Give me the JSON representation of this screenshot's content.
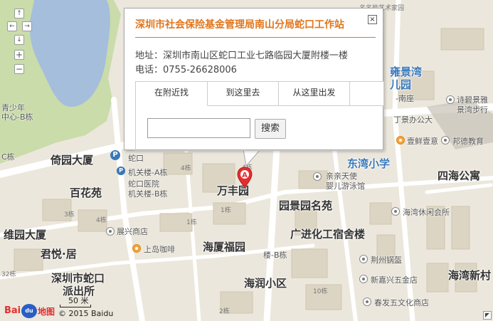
{
  "popup": {
    "title": "深圳市社会保险基金管理局南山分局蛇口工作站",
    "address": "地址：深圳市南山区蛇口工业七路临园大厦附楼一楼",
    "phone": "电话：0755-26628006",
    "close_icon": "×",
    "tabs": [
      "在附近找",
      "到这里去",
      "从这里出发"
    ],
    "search_value": "",
    "search_button": "搜索"
  },
  "nav": {
    "up": "↑",
    "left": "←",
    "right": "→",
    "down": "↓",
    "zoom_in": "+",
    "zoom_out": "−"
  },
  "marker_label": "A",
  "labels": {
    "top_clip": "名名能艺术家园",
    "yongjing": "雍景湾",
    "ergarden": "儿园",
    "nanzuo": "-南座",
    "shijing": "诗碧景雅",
    "shijing2": "景湾步行",
    "jingxiao": "丁景办公大",
    "yixian": "壹鲜壹意",
    "bangde": "邦德教育",
    "wanxiao": "东湾小学",
    "sihai": "四海公寓",
    "qinqin": "亲亲天使",
    "qinqin2": "婴儿游泳馆",
    "yuanjing": "园景园名苑",
    "haiwan_club": "海湾休闲会所",
    "guangxi": "广进化工宿舍楼",
    "jingzhou": "荆州锅盔",
    "xinjia": "新嘉兴五金店",
    "haiwan_new": "海湾新村",
    "chunfa": "春发五文化商店",
    "hairun": "海润小区",
    "qingnian": "青少年",
    "qingnian2": "中心-B栋",
    "ce": "C栋",
    "yiyuan": "倚园大厦",
    "baihua": "百花苑",
    "weiyuan": "维园大厦",
    "junyue": "君悦·居",
    "shekou_police": "深圳市蛇口",
    "shekou_police2": "派出所",
    "wanfeng": "万丰园",
    "haixia": "海厦福园",
    "zhanxing": "展兴商店",
    "shangdao": "上岛咖啡",
    "jiguan_a": "机关楼-A栋",
    "jiguan_b": "机关楼-B栋",
    "yiyuan_hosp": "蛇口医院",
    "shekou_clip": "蛇口",
    "lou_b": "楼-B栋",
    "n4a": "4栋",
    "n4b": "4栋",
    "n3": "3栋",
    "n4c": "4栋",
    "n1": "1栋",
    "n1b": "1栋",
    "n10": "10栋",
    "n2": "2栋",
    "n32": "32栋",
    "p": "P",
    "p2": "P"
  },
  "scale": "50 米",
  "copyright": "© 2015 Baidu",
  "logo": {
    "text_a": "Bai",
    "text_b": "地图",
    "paw": "du"
  },
  "colors": {
    "accent": "#e0761c",
    "water": "#a5bedc",
    "green": "#c9dcaa",
    "road": "#ffffff",
    "marker": "#e22e2e"
  }
}
